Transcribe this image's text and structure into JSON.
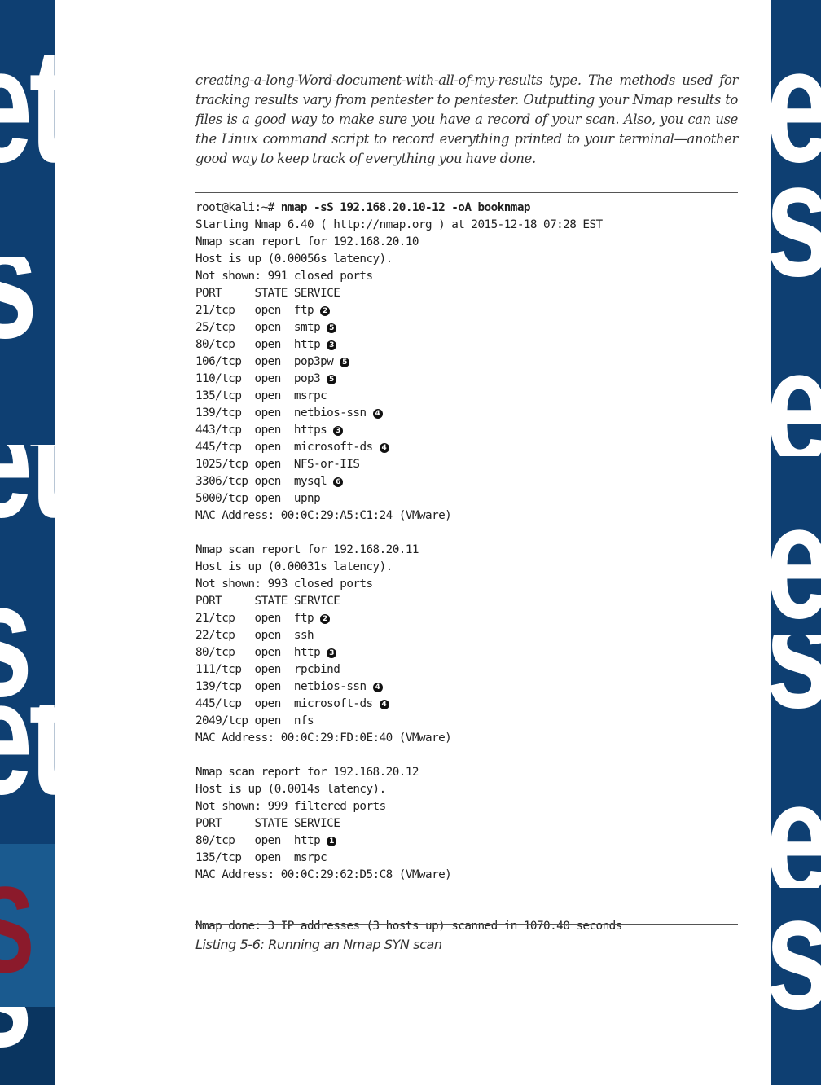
{
  "background": {
    "panel_color": "#0e3f72",
    "glyph_color": "#ffffff",
    "accent_color": "#8b1a2b",
    "left_tiles": [
      "et",
      "s",
      "et",
      "s",
      "et",
      "s",
      "S"
    ],
    "right_tiles": [
      "et",
      "s",
      "et",
      "s",
      "et",
      "s",
      "et",
      "s"
    ]
  },
  "intro_paragraph": "creating-a-long-Word-document-with-all-of-my-results type. The methods used for tracking results vary from pentester to pentester. Outputting your Nmap results to files is a good way to make sure you have a record of your scan. Also, you can use the Linux command script to record everything printed to your terminal—another good way to keep track of everything you have done.",
  "listing": {
    "prompt": "root@kali:~# ",
    "command": "nmap -sS 192.168.20.10-12 -oA booknmap",
    "start_line": "Starting Nmap 6.40 ( http://nmap.org ) at 2015-12-18 07:28 EST",
    "header_row": "PORT     STATE SERVICE",
    "hosts": [
      {
        "report": "Nmap scan report for 192.168.20.10",
        "host_up": "Host is up (0.00056s latency).",
        "not_shown": "Not shown: 991 closed ports",
        "ports": [
          {
            "port": "21/tcp",
            "state": "open",
            "service": "ftp",
            "callout": "2"
          },
          {
            "port": "25/tcp",
            "state": "open",
            "service": "smtp",
            "callout": "5"
          },
          {
            "port": "80/tcp",
            "state": "open",
            "service": "http",
            "callout": "3"
          },
          {
            "port": "106/tcp",
            "state": "open",
            "service": "pop3pw",
            "callout": "5"
          },
          {
            "port": "110/tcp",
            "state": "open",
            "service": "pop3",
            "callout": "5"
          },
          {
            "port": "135/tcp",
            "state": "open",
            "service": "msrpc",
            "callout": ""
          },
          {
            "port": "139/tcp",
            "state": "open",
            "service": "netbios-ssn",
            "callout": "4"
          },
          {
            "port": "443/tcp",
            "state": "open",
            "service": "https",
            "callout": "3"
          },
          {
            "port": "445/tcp",
            "state": "open",
            "service": "microsoft-ds",
            "callout": "4"
          },
          {
            "port": "1025/tcp",
            "state": "open",
            "service": "NFS-or-IIS",
            "callout": ""
          },
          {
            "port": "3306/tcp",
            "state": "open",
            "service": "mysql",
            "callout": "6"
          },
          {
            "port": "5000/tcp",
            "state": "open",
            "service": "upnp",
            "callout": ""
          }
        ],
        "mac": "MAC Address: 00:0C:29:A5:C1:24 (VMware)"
      },
      {
        "report": "Nmap scan report for 192.168.20.11",
        "host_up": "Host is up (0.00031s latency).",
        "not_shown": "Not shown: 993 closed ports",
        "ports": [
          {
            "port": "21/tcp",
            "state": "open",
            "service": "ftp",
            "callout": "2"
          },
          {
            "port": "22/tcp",
            "state": "open",
            "service": "ssh",
            "callout": ""
          },
          {
            "port": "80/tcp",
            "state": "open",
            "service": "http",
            "callout": "3"
          },
          {
            "port": "111/tcp",
            "state": "open",
            "service": "rpcbind",
            "callout": ""
          },
          {
            "port": "139/tcp",
            "state": "open",
            "service": "netbios-ssn",
            "callout": "4"
          },
          {
            "port": "445/tcp",
            "state": "open",
            "service": "microsoft-ds",
            "callout": "4"
          },
          {
            "port": "2049/tcp",
            "state": "open",
            "service": "nfs",
            "callout": ""
          }
        ],
        "mac": "MAC Address: 00:0C:29:FD:0E:40 (VMware)"
      },
      {
        "report": "Nmap scan report for 192.168.20.12",
        "host_up": "Host is up (0.0014s latency).",
        "not_shown": "Not shown: 999 filtered ports",
        "ports": [
          {
            "port": "80/tcp",
            "state": "open",
            "service": "http",
            "callout": "1"
          },
          {
            "port": "135/tcp",
            "state": "open",
            "service": "msrpc",
            "callout": ""
          }
        ],
        "mac": "MAC Address: 00:0C:29:62:D5:C8 (VMware)"
      }
    ],
    "done_line": "Nmap done: 3 IP addresses (3 hosts up) scanned in 1070.40 seconds"
  },
  "caption": "Listing 5-6: Running an Nmap SYN scan"
}
